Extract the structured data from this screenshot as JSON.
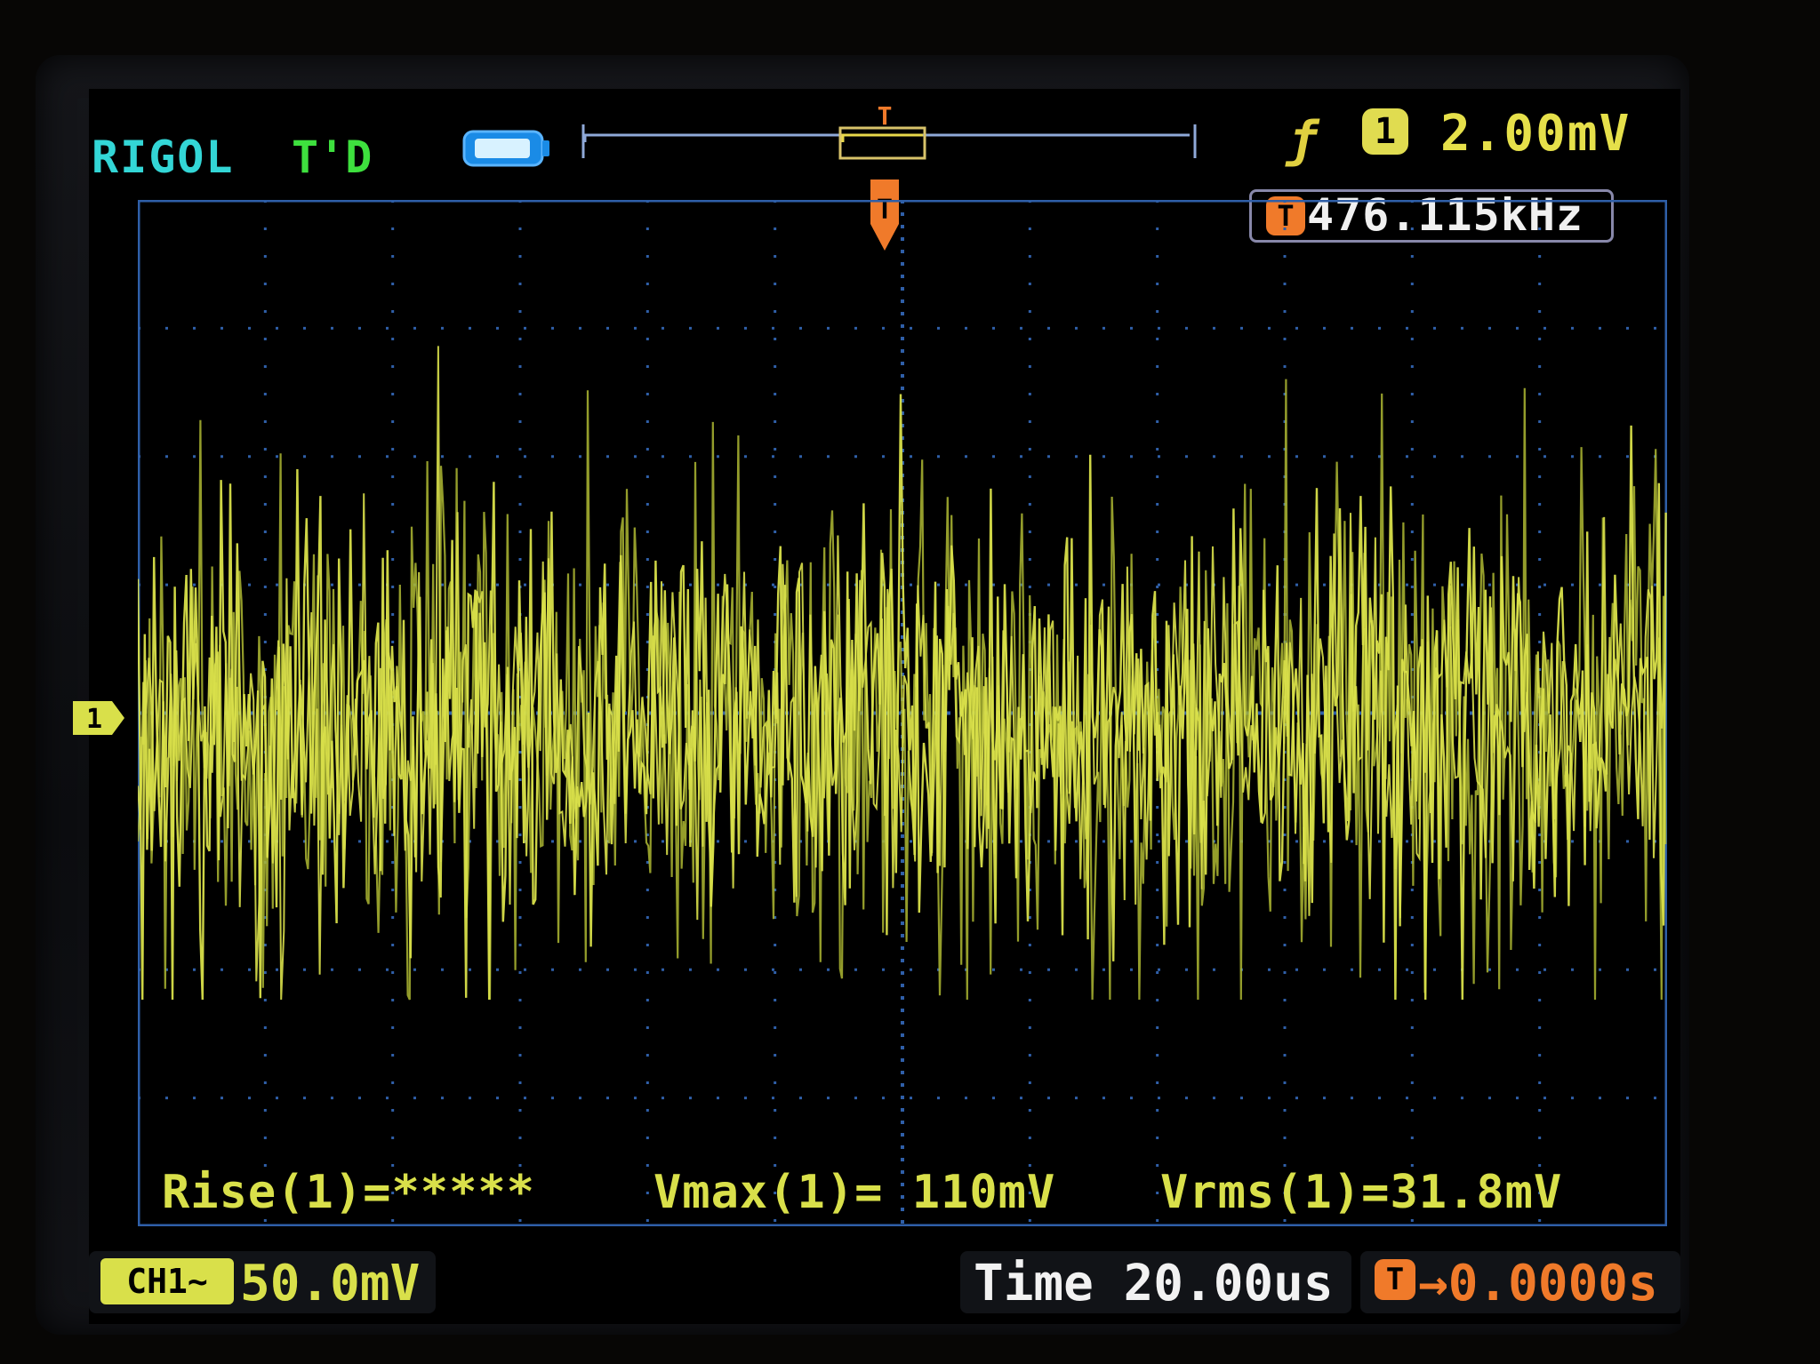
{
  "colors": {
    "channel": "#d9e04a",
    "channel_dim": "#aeb832",
    "brand": "#33d6d6",
    "mode": "#3ee03e",
    "trigger": "#f07a2a",
    "grid": "#2f5fa8",
    "text_white": "#f2f2f2"
  },
  "header": {
    "brand": "RIGOL",
    "mode": "T'D",
    "battery_icon": "memory-depth-icon",
    "trigger_edge_icon": "rising-edge-icon",
    "trigger_channel": "1",
    "trigger_level": "2.00mV",
    "frequency_badge": "T",
    "frequency": "476.115kHz"
  },
  "channel": {
    "marker_label": "1",
    "scale_badge": "CH1~",
    "scale": "50.0mV"
  },
  "measurements": {
    "rise": "Rise(1)=*****",
    "vmax": "Vmax(1)= 110mV",
    "vrms": "Vrms(1)=31.8mV"
  },
  "timebase": {
    "time": "Time 20.00us",
    "trigger_badge": "T",
    "trigger_offset": "→0.0000s"
  },
  "trigger_markers": {
    "top_label": "T",
    "pointer_label": "T"
  }
}
